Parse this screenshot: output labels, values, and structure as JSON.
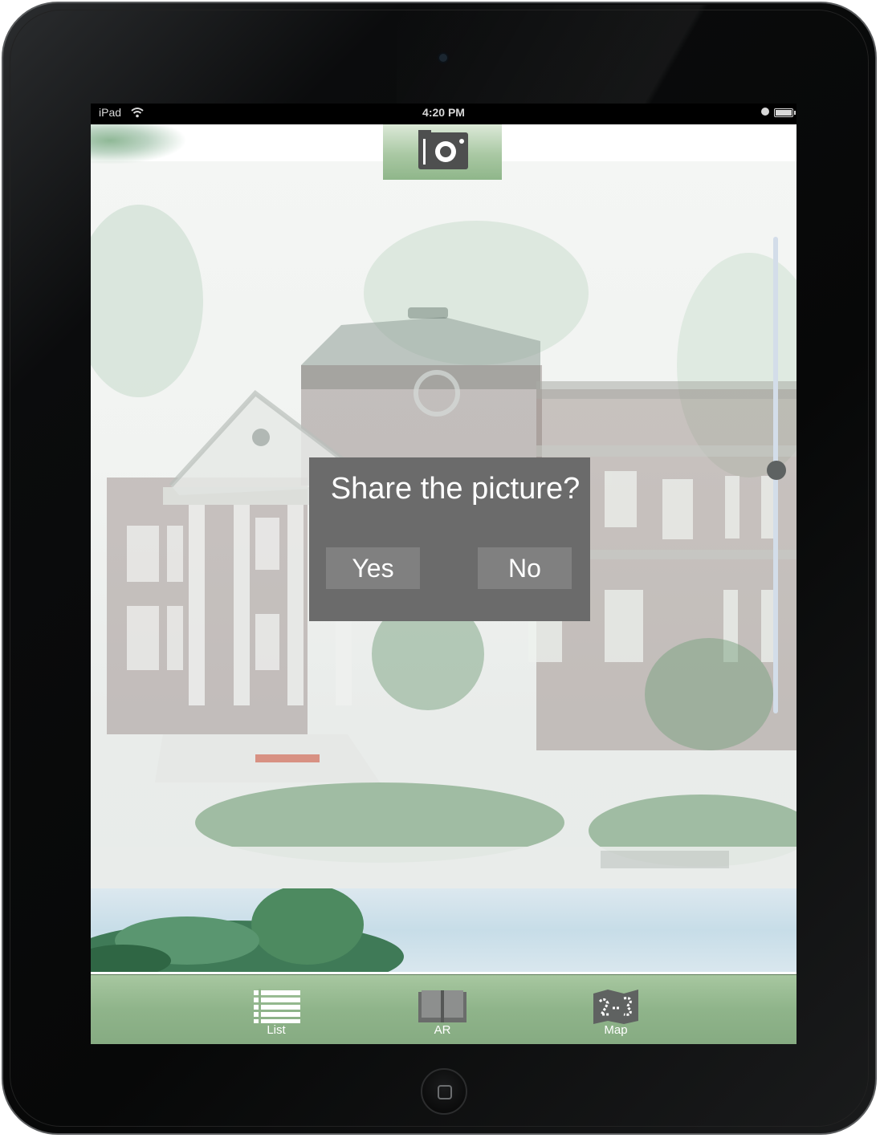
{
  "status_bar": {
    "carrier": "iPad",
    "time": "4:20 PM"
  },
  "dialog": {
    "title": "Share the picture?",
    "yes_label": "Yes",
    "no_label": "No"
  },
  "zoom": {
    "level": 0.49
  },
  "tabs": [
    {
      "label": "List",
      "icon": "list-icon"
    },
    {
      "label": "AR",
      "icon": "book-icon"
    },
    {
      "label": "Map",
      "icon": "map-icon"
    }
  ],
  "colors": {
    "tabbar_green": "#8fb48a",
    "dialog_gray": "#6b6b6b",
    "button_gray": "#808080",
    "slider_track": "#d3dde9"
  }
}
